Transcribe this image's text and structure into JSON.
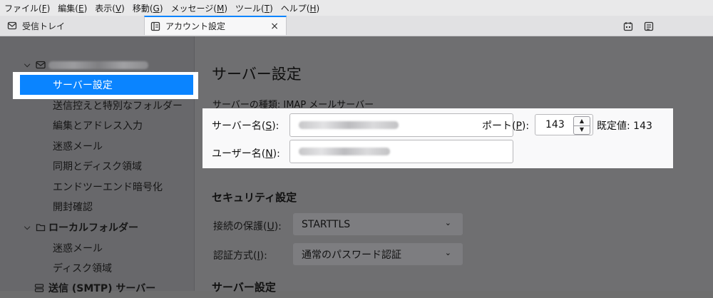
{
  "menubar": {
    "items": [
      {
        "label": "ファイル(",
        "key": "F",
        "tail": ")"
      },
      {
        "label": "編集(",
        "key": "E",
        "tail": ")"
      },
      {
        "label": "表示(",
        "key": "V",
        "tail": ")"
      },
      {
        "label": "移動(",
        "key": "G",
        "tail": ")"
      },
      {
        "label": "メッセージ(",
        "key": "M",
        "tail": ")"
      },
      {
        "label": "ツール(",
        "key": "T",
        "tail": ")"
      },
      {
        "label": "ヘルプ(",
        "key": "H",
        "tail": ")"
      }
    ]
  },
  "tabs": {
    "inbox": {
      "label": "受信トレイ",
      "icon": "envelope-icon"
    },
    "account": {
      "label": "アカウント設定",
      "icon": "account-settings-icon",
      "close": "×"
    }
  },
  "toolbar": {
    "icons": [
      "calendar-icon",
      "tasks-icon"
    ]
  },
  "sidebar": {
    "selected": "サーバー設定",
    "items": [
      "送信控えと特別なフォルダー",
      "編集とアドレス入力",
      "迷惑メール",
      "同期とディスク領域",
      "エンドツーエンド暗号化",
      "開封確認"
    ],
    "local_folders": "ローカルフォルダー",
    "local_items": [
      "迷惑メール",
      "ディスク領域"
    ],
    "smtp": "送信 (SMTP) サーバー"
  },
  "main": {
    "title": "サーバー設定",
    "server_type": "サーバーの種類: IMAP メールサーバー",
    "server_name_label": "サーバー名(",
    "server_name_key": "S",
    "server_name_tail": "):",
    "port_label": "ポート(",
    "port_key": "P",
    "port_tail": "):",
    "port_value": "143",
    "default_label": "既定値: 143",
    "username_label": "ユーザー名(",
    "username_key": "N",
    "username_tail": "):",
    "security_title": "セキュリティ設定",
    "connection_label": "接続の保護(",
    "connection_key": "U",
    "connection_tail": "):",
    "connection_value": "STARTTLS",
    "auth_label": "認証方式(",
    "auth_key": "I",
    "auth_tail": "):",
    "auth_value": "通常のパスワード認証",
    "server_settings_title": "サーバー設定"
  }
}
